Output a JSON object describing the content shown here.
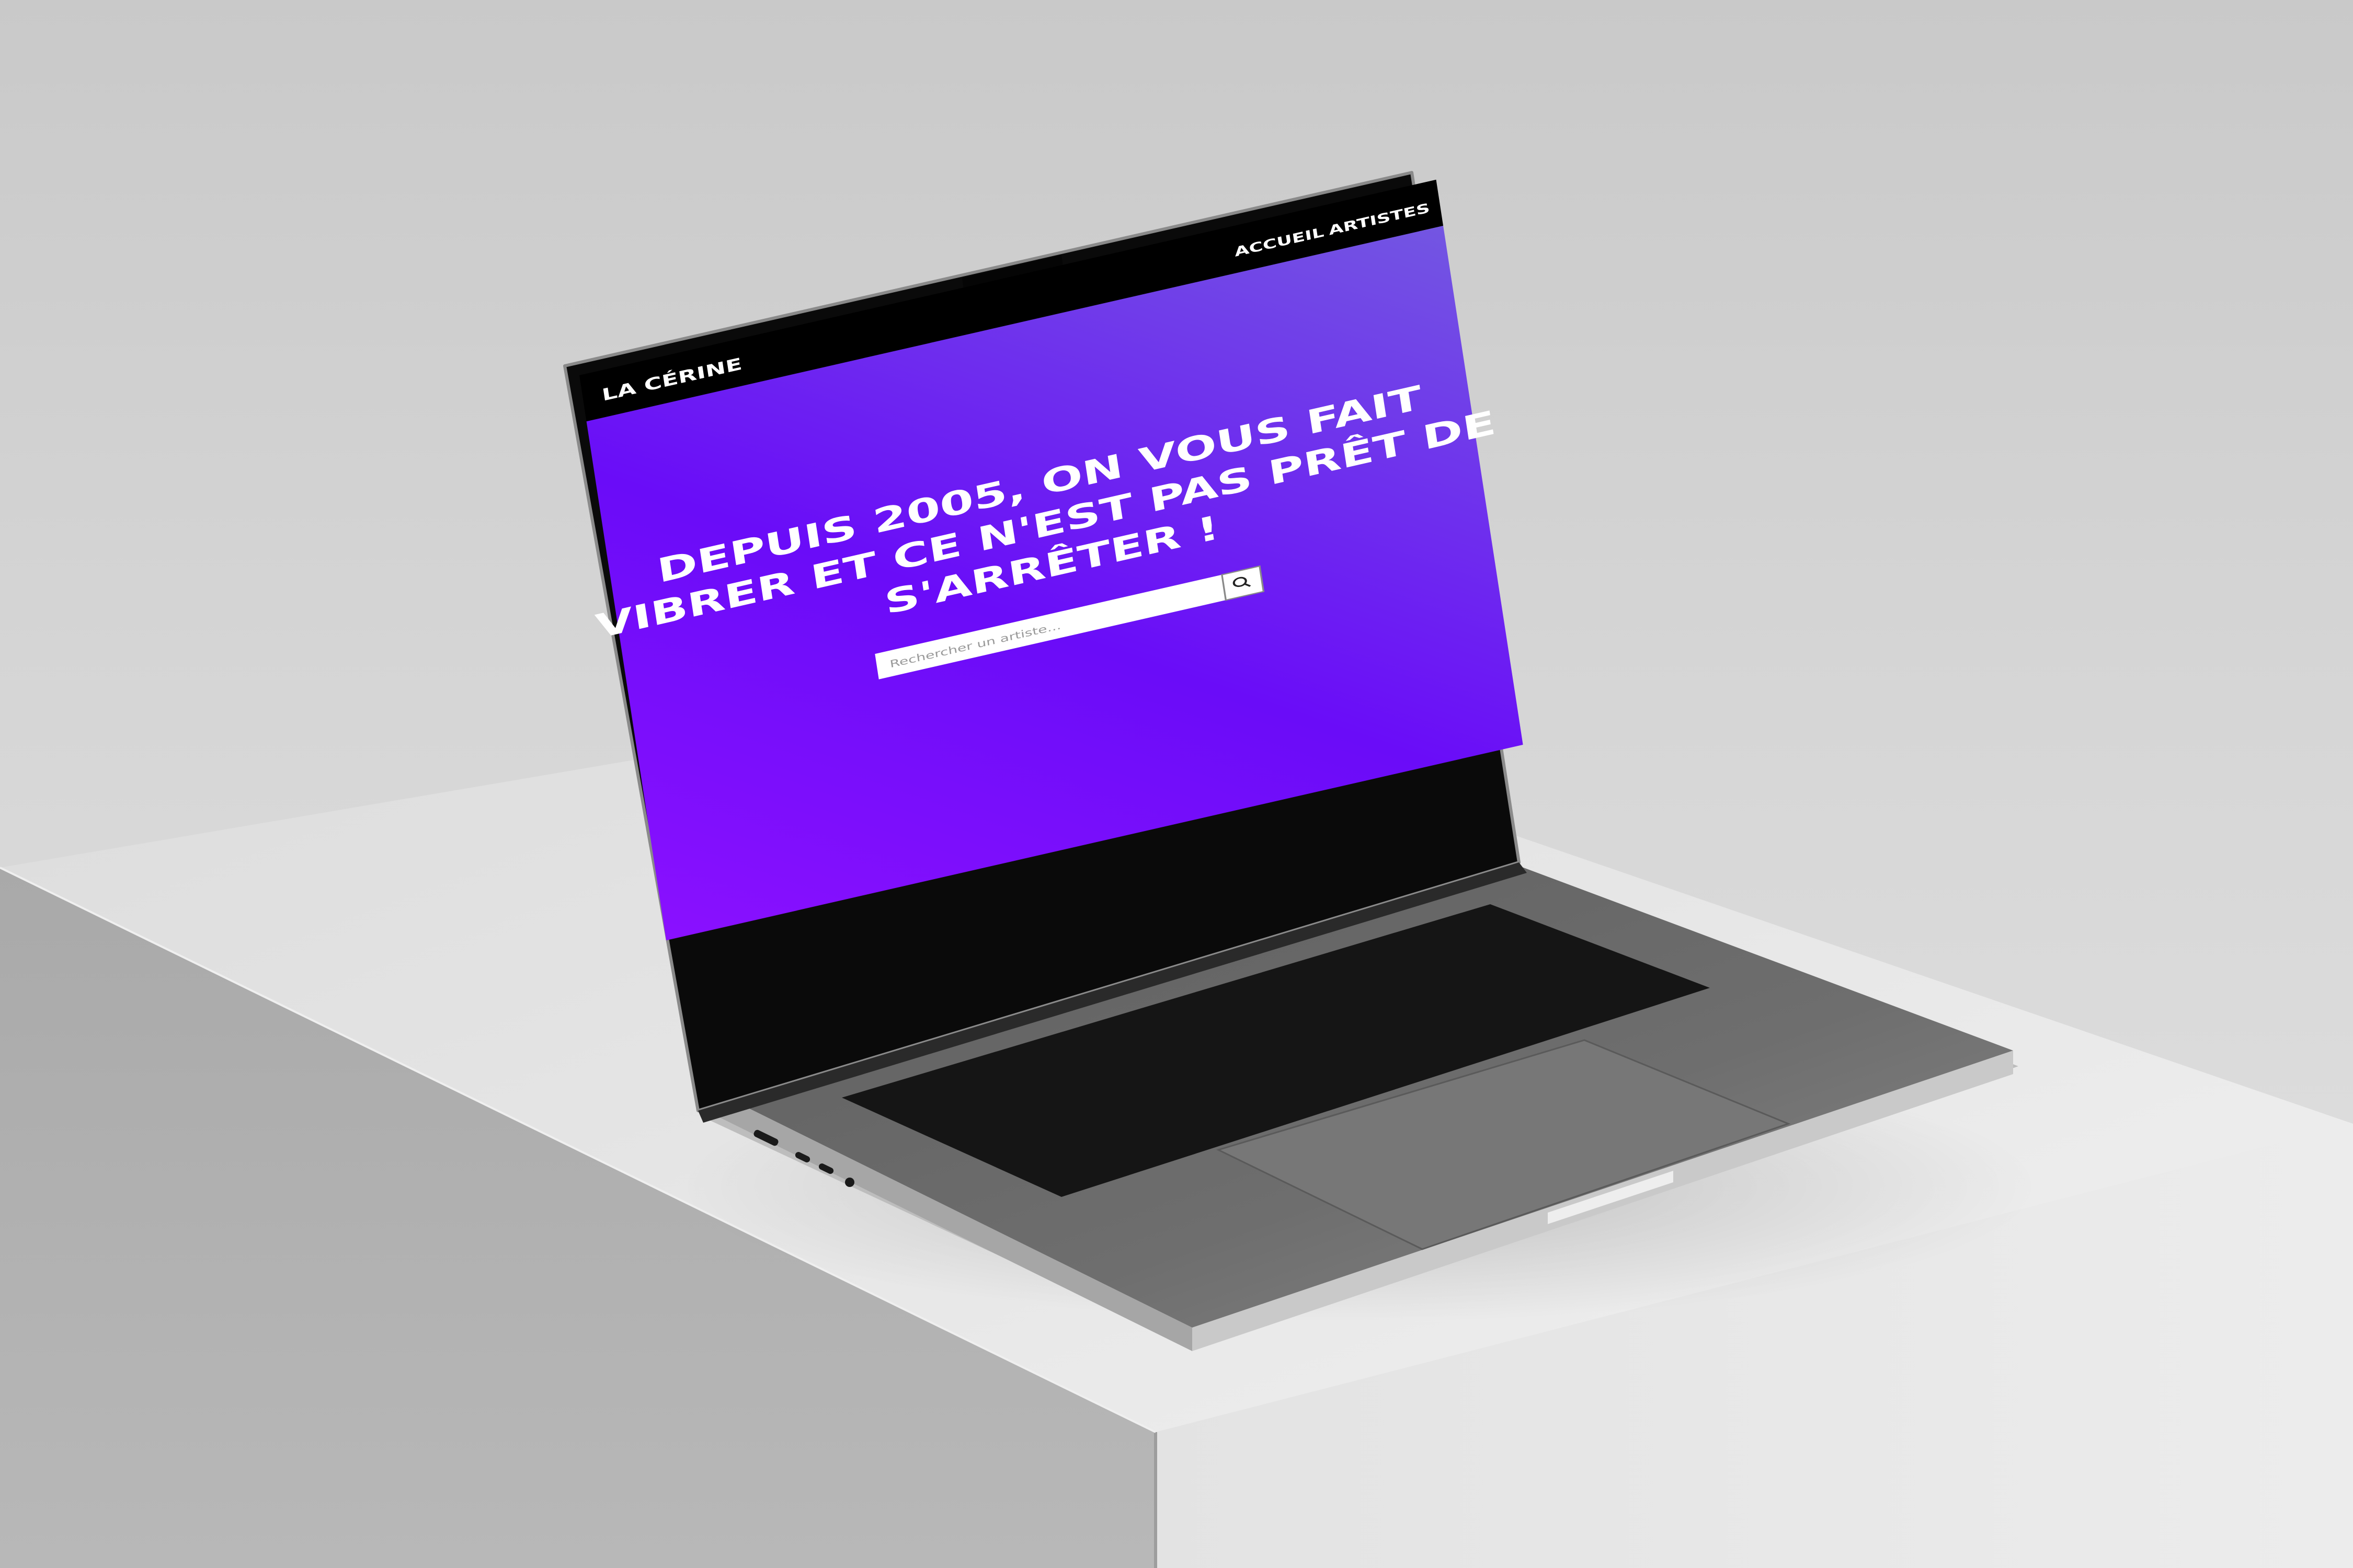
{
  "site": {
    "brand": "LA CÉRINE",
    "nav": [
      {
        "label": "ACCUEIL"
      },
      {
        "label": "ARTISTES"
      }
    ]
  },
  "hero": {
    "headline_lines": [
      "DEPUIS 2005, ON VOUS FAIT",
      "VIBRER ET CE N'EST PAS PRÊT DE",
      "S'ARRÊTER !"
    ],
    "search": {
      "placeholder": "Rechercher un artiste...",
      "button_icon": "search-icon"
    }
  },
  "colors": {
    "hero_gradient_start": "#6a0dff",
    "hero_gradient_end": "#7a5ae0",
    "navbar": "#000000",
    "laptop_body": "#6b6b6b"
  }
}
